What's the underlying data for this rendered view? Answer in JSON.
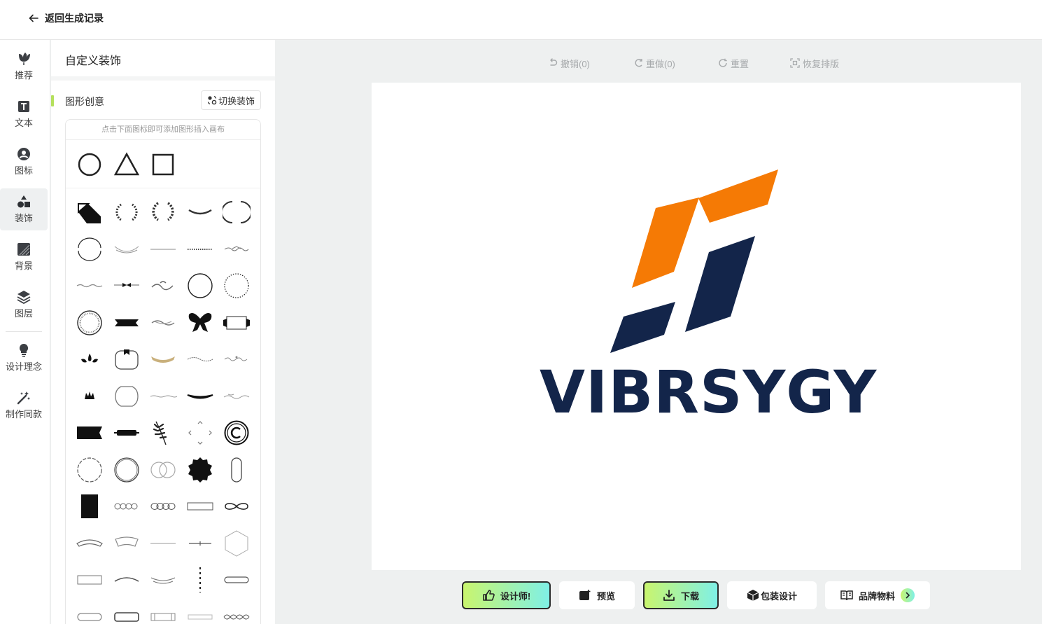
{
  "header": {
    "back_label": "返回生成记录"
  },
  "nav": {
    "items": [
      {
        "key": "recommend",
        "label": "推荐",
        "icon": "tulip-icon"
      },
      {
        "key": "text",
        "label": "文本",
        "icon": "text-t-icon"
      },
      {
        "key": "icon",
        "label": "图标",
        "icon": "user-circle-icon"
      },
      {
        "key": "decoration",
        "label": "装饰",
        "icon": "shapes-icon",
        "active": true
      },
      {
        "key": "background",
        "label": "背景",
        "icon": "background-icon"
      },
      {
        "key": "layers",
        "label": "图层",
        "icon": "layers-icon"
      },
      {
        "key": "concept",
        "label": "设计理念",
        "icon": "lightbulb-icon"
      },
      {
        "key": "same",
        "label": "制作同款",
        "icon": "magic-wand-icon"
      }
    ]
  },
  "panel": {
    "title": "自定义装饰",
    "section_title": "图形创意",
    "switch_label": "切换装饰",
    "hint": "点击下面图标即可添加图形插入画布",
    "basic_shapes": [
      "circle",
      "triangle",
      "square"
    ],
    "decorations": [
      "corner-fold",
      "laurel-wreath",
      "laurel-open",
      "swash-curve",
      "bracket-circle",
      "arc-pair",
      "smile-arc",
      "thin-line",
      "dotted-line",
      "ornament-line",
      "flourish",
      "bow-divider",
      "swirl-divider",
      "plain-circle",
      "dotted-circle",
      "beaded-circle",
      "ribbon-banner",
      "scroll-divider",
      "bow-tie",
      "ribbon-frame",
      "fleur-drop",
      "tag-frame",
      "gold-ribbon",
      "lace-line",
      "curl-line",
      "crown",
      "ornate-oval",
      "tilde-line",
      "thick-swash",
      "wave-line",
      "arrow-banner",
      "pill-banner",
      "leaf-branch",
      "arrow-cross",
      "copyright-circle",
      "dashed-circle",
      "double-ring",
      "twin-circles",
      "scalloped-badge",
      "capsule-vertical",
      "black-rect",
      "chain-four",
      "chain-oval",
      "thin-rect",
      "infinity-loop",
      "ribbon-arc",
      "curved-banner",
      "line-thin",
      "cross-line",
      "hexagon",
      "thin-box",
      "smile-curve",
      "double-smile",
      "vertical-dashes",
      "rounded-bar",
      "pill-outline",
      "rounded-rect",
      "bracket-rect",
      "thin-bar",
      "rope-twist"
    ]
  },
  "toolbar": {
    "undo": "撤销(0)",
    "redo": "重做(0)",
    "reset": "重置",
    "restore": "恢复排版"
  },
  "canvas": {
    "brand": "VIBRSYGY",
    "colors": {
      "orange": "#f57a05",
      "navy": "#13254a"
    }
  },
  "bottom": {
    "designer": "设计师!",
    "preview": "预览",
    "download": "下载",
    "packaging": "包装设计",
    "materials": "品牌物料"
  },
  "colors": {
    "accent_green": "#b4e05c",
    "gradient_end": "#7ff0e6",
    "canvas_bg": "#eef0f0"
  }
}
